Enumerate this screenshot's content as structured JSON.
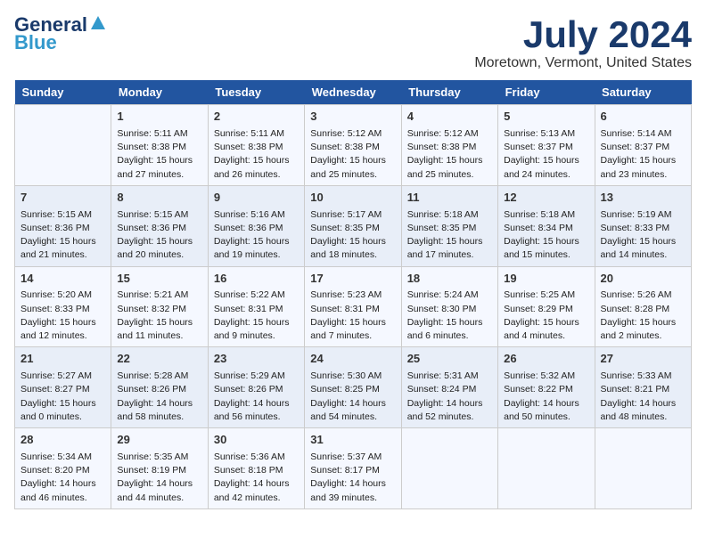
{
  "header": {
    "logo_line1": "General",
    "logo_line2": "Blue",
    "title": "July 2024",
    "subtitle": "Moretown, Vermont, United States"
  },
  "days_of_week": [
    "Sunday",
    "Monday",
    "Tuesday",
    "Wednesday",
    "Thursday",
    "Friday",
    "Saturday"
  ],
  "weeks": [
    [
      {
        "day": "",
        "content": ""
      },
      {
        "day": "1",
        "content": "Sunrise: 5:11 AM\nSunset: 8:38 PM\nDaylight: 15 hours\nand 27 minutes."
      },
      {
        "day": "2",
        "content": "Sunrise: 5:11 AM\nSunset: 8:38 PM\nDaylight: 15 hours\nand 26 minutes."
      },
      {
        "day": "3",
        "content": "Sunrise: 5:12 AM\nSunset: 8:38 PM\nDaylight: 15 hours\nand 25 minutes."
      },
      {
        "day": "4",
        "content": "Sunrise: 5:12 AM\nSunset: 8:38 PM\nDaylight: 15 hours\nand 25 minutes."
      },
      {
        "day": "5",
        "content": "Sunrise: 5:13 AM\nSunset: 8:37 PM\nDaylight: 15 hours\nand 24 minutes."
      },
      {
        "day": "6",
        "content": "Sunrise: 5:14 AM\nSunset: 8:37 PM\nDaylight: 15 hours\nand 23 minutes."
      }
    ],
    [
      {
        "day": "7",
        "content": "Sunrise: 5:15 AM\nSunset: 8:36 PM\nDaylight: 15 hours\nand 21 minutes."
      },
      {
        "day": "8",
        "content": "Sunrise: 5:15 AM\nSunset: 8:36 PM\nDaylight: 15 hours\nand 20 minutes."
      },
      {
        "day": "9",
        "content": "Sunrise: 5:16 AM\nSunset: 8:36 PM\nDaylight: 15 hours\nand 19 minutes."
      },
      {
        "day": "10",
        "content": "Sunrise: 5:17 AM\nSunset: 8:35 PM\nDaylight: 15 hours\nand 18 minutes."
      },
      {
        "day": "11",
        "content": "Sunrise: 5:18 AM\nSunset: 8:35 PM\nDaylight: 15 hours\nand 17 minutes."
      },
      {
        "day": "12",
        "content": "Sunrise: 5:18 AM\nSunset: 8:34 PM\nDaylight: 15 hours\nand 15 minutes."
      },
      {
        "day": "13",
        "content": "Sunrise: 5:19 AM\nSunset: 8:33 PM\nDaylight: 15 hours\nand 14 minutes."
      }
    ],
    [
      {
        "day": "14",
        "content": "Sunrise: 5:20 AM\nSunset: 8:33 PM\nDaylight: 15 hours\nand 12 minutes."
      },
      {
        "day": "15",
        "content": "Sunrise: 5:21 AM\nSunset: 8:32 PM\nDaylight: 15 hours\nand 11 minutes."
      },
      {
        "day": "16",
        "content": "Sunrise: 5:22 AM\nSunset: 8:31 PM\nDaylight: 15 hours\nand 9 minutes."
      },
      {
        "day": "17",
        "content": "Sunrise: 5:23 AM\nSunset: 8:31 PM\nDaylight: 15 hours\nand 7 minutes."
      },
      {
        "day": "18",
        "content": "Sunrise: 5:24 AM\nSunset: 8:30 PM\nDaylight: 15 hours\nand 6 minutes."
      },
      {
        "day": "19",
        "content": "Sunrise: 5:25 AM\nSunset: 8:29 PM\nDaylight: 15 hours\nand 4 minutes."
      },
      {
        "day": "20",
        "content": "Sunrise: 5:26 AM\nSunset: 8:28 PM\nDaylight: 15 hours\nand 2 minutes."
      }
    ],
    [
      {
        "day": "21",
        "content": "Sunrise: 5:27 AM\nSunset: 8:27 PM\nDaylight: 15 hours\nand 0 minutes."
      },
      {
        "day": "22",
        "content": "Sunrise: 5:28 AM\nSunset: 8:26 PM\nDaylight: 14 hours\nand 58 minutes."
      },
      {
        "day": "23",
        "content": "Sunrise: 5:29 AM\nSunset: 8:26 PM\nDaylight: 14 hours\nand 56 minutes."
      },
      {
        "day": "24",
        "content": "Sunrise: 5:30 AM\nSunset: 8:25 PM\nDaylight: 14 hours\nand 54 minutes."
      },
      {
        "day": "25",
        "content": "Sunrise: 5:31 AM\nSunset: 8:24 PM\nDaylight: 14 hours\nand 52 minutes."
      },
      {
        "day": "26",
        "content": "Sunrise: 5:32 AM\nSunset: 8:22 PM\nDaylight: 14 hours\nand 50 minutes."
      },
      {
        "day": "27",
        "content": "Sunrise: 5:33 AM\nSunset: 8:21 PM\nDaylight: 14 hours\nand 48 minutes."
      }
    ],
    [
      {
        "day": "28",
        "content": "Sunrise: 5:34 AM\nSunset: 8:20 PM\nDaylight: 14 hours\nand 46 minutes."
      },
      {
        "day": "29",
        "content": "Sunrise: 5:35 AM\nSunset: 8:19 PM\nDaylight: 14 hours\nand 44 minutes."
      },
      {
        "day": "30",
        "content": "Sunrise: 5:36 AM\nSunset: 8:18 PM\nDaylight: 14 hours\nand 42 minutes."
      },
      {
        "day": "31",
        "content": "Sunrise: 5:37 AM\nSunset: 8:17 PM\nDaylight: 14 hours\nand 39 minutes."
      },
      {
        "day": "",
        "content": ""
      },
      {
        "day": "",
        "content": ""
      },
      {
        "day": "",
        "content": ""
      }
    ]
  ]
}
